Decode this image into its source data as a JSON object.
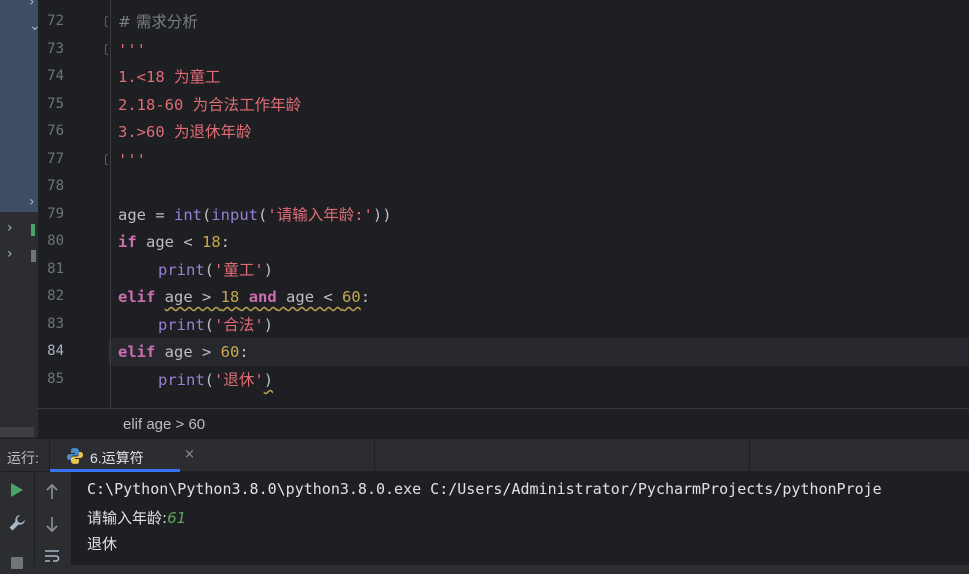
{
  "editor": {
    "lines": [
      {
        "num": "72",
        "cur": false
      },
      {
        "num": "73",
        "cur": false
      },
      {
        "num": "74",
        "cur": false
      },
      {
        "num": "75",
        "cur": false
      },
      {
        "num": "76",
        "cur": false
      },
      {
        "num": "77",
        "cur": false
      },
      {
        "num": "78",
        "cur": false
      },
      {
        "num": "79",
        "cur": false
      },
      {
        "num": "80",
        "cur": false
      },
      {
        "num": "81",
        "cur": false
      },
      {
        "num": "82",
        "cur": false
      },
      {
        "num": "83",
        "cur": false
      },
      {
        "num": "84",
        "cur": true
      },
      {
        "num": "85",
        "cur": false
      }
    ],
    "code": {
      "l72": "# 需求分析",
      "l73": "'''",
      "l74": "1.<18 为童工",
      "l75": "2.18-60 为合法工作年龄",
      "l76": "3.>60 为退休年龄",
      "l77": "'''",
      "l79_age": "age = ",
      "l79_int": "int",
      "l79_p1": "(",
      "l79_input": "input",
      "l79_p2": "(",
      "l79_str": "'请输入年龄:'",
      "l79_p3": "))",
      "l80_if": "if",
      "l80_mid": " age < ",
      "l80_num": "18",
      "l80_colon": ":",
      "l81_print": "print",
      "l81_p1": "(",
      "l81_str": "'童工'",
      "l81_p2": ")",
      "l82_elif": "elif",
      "l82_sp": " ",
      "l82_a": "age > ",
      "l82_n1": "18",
      "l82_sp2": " ",
      "l82_and": "and",
      "l82_sp3": " ",
      "l82_b": "age < ",
      "l82_n2": "60",
      "l82_colon": ":",
      "l83_print": "print",
      "l83_p1": "(",
      "l83_str": "'合法'",
      "l83_p2": ")",
      "l84_elif": "elif",
      "l84_mid": " age > ",
      "l84_num": "60",
      "l84_colon": ":",
      "l85_print": "print",
      "l85_p1": "(",
      "l85_str": "'退休'",
      "l85_p2": ")"
    },
    "breadcrumb": "elif age > 60"
  },
  "run_panel": {
    "label": "运行:",
    "tab_name": "6.运算符",
    "close_glyph": "×",
    "console": {
      "command": "C:\\Python\\Python3.8.0\\python3.8.0.exe C:/Users/Administrator/PycharmProjects/pythonProje",
      "prompt": "请输入年龄:",
      "input_value": "61",
      "output": "退休"
    }
  },
  "colors": {
    "accent": "#3574f0",
    "run_green": "#4aa36b",
    "string": "#e06c75",
    "keyword": "#cf8e6d",
    "number": "#c9a84c",
    "builtin": "#9b7fd4"
  },
  "icons": [
    "run-icon",
    "wrench-icon",
    "stop-icon",
    "up-arrow-icon",
    "down-arrow-icon",
    "soft-wrap-icon",
    "python-icon",
    "chevron-right-icon"
  ]
}
